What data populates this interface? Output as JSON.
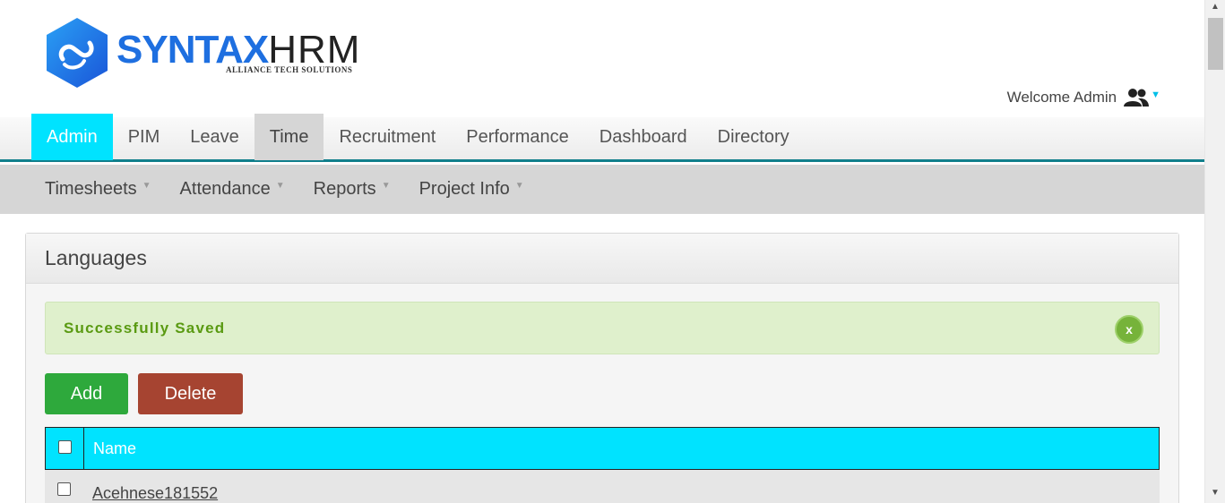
{
  "logo": {
    "brand_part1": "SYNTAX",
    "brand_part2": "HRM",
    "tagline": "ALLIANCE TECH SOLUTIONS",
    "color_primary": "#1e6fe0"
  },
  "header": {
    "welcome_text": "Welcome Admin",
    "user_icon": "users-icon"
  },
  "main_nav": {
    "tabs": [
      {
        "label": "Admin",
        "state": "active"
      },
      {
        "label": "PIM"
      },
      {
        "label": "Leave"
      },
      {
        "label": "Time",
        "state": "current"
      },
      {
        "label": "Recruitment"
      },
      {
        "label": "Performance"
      },
      {
        "label": "Dashboard"
      },
      {
        "label": "Directory"
      }
    ],
    "active_color": "#00e3ff",
    "border_color": "#117f8c"
  },
  "sub_nav": {
    "items": [
      {
        "label": "Timesheets"
      },
      {
        "label": "Attendance"
      },
      {
        "label": "Reports"
      },
      {
        "label": "Project Info"
      }
    ]
  },
  "panel": {
    "title": "Languages",
    "alert": {
      "message": "Successfully Saved",
      "close_label": "x",
      "color": "#5a9a12"
    },
    "buttons": {
      "add_label": "Add",
      "delete_label": "Delete",
      "add_color": "#2ea93c",
      "delete_color": "#a64431"
    },
    "table": {
      "header_name": "Name",
      "header_color": "#00e3ff",
      "rows": [
        {
          "name": "Acehnese181552"
        }
      ]
    }
  }
}
